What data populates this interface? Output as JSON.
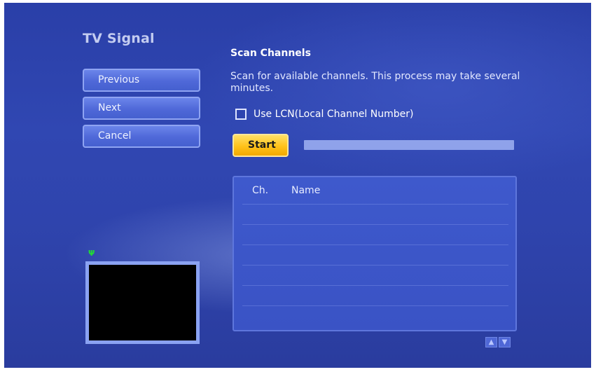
{
  "page_title": "TV Signal",
  "nav": {
    "previous_label": "Previous",
    "next_label": "Next",
    "cancel_label": "Cancel"
  },
  "scan": {
    "title": "Scan Channels",
    "description": "Scan for available channels. This process may take several minutes.",
    "lcn_label": "Use LCN(Local Channel Number)",
    "lcn_checked": false,
    "start_label": "Start",
    "progress": 0
  },
  "channel_list": {
    "columns": [
      "Ch.",
      "Name"
    ],
    "rows": []
  },
  "scroll": {
    "up_icon": "chevron-up-icon",
    "down_icon": "chevron-down-icon"
  },
  "preview": {
    "signal_icon": "signal-antenna-icon"
  },
  "colors": {
    "background": "#2f44ad",
    "button": "#5670db",
    "start_button": "#ffc21a",
    "signal": "#22dd33"
  }
}
